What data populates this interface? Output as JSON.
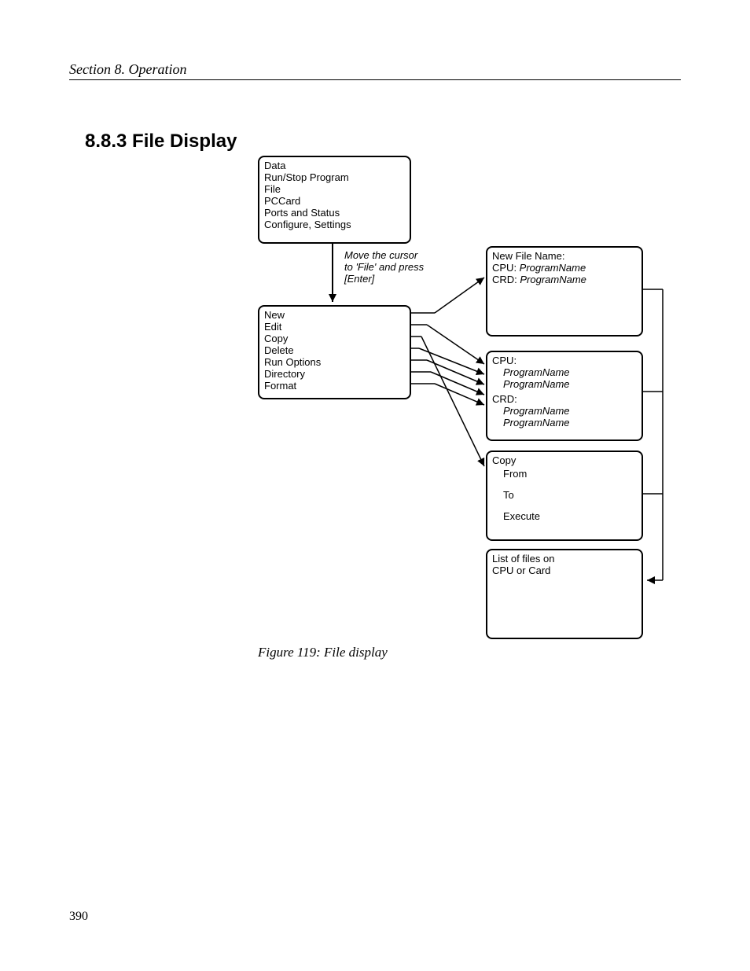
{
  "header": "Section 8.  Operation",
  "section_title": "8.8.3 File Display",
  "caption": "Figure 119: File display",
  "page_number": "390",
  "box_main": {
    "l1": "Data",
    "l2": "Run/Stop Program",
    "l3": "File",
    "l4": "PCCard",
    "l5": "Ports and Status",
    "l6": "Configure, Settings"
  },
  "instr": {
    "l1": "Move the cursor",
    "l2": "to 'File' and press",
    "l3": "[Enter]"
  },
  "box_file": {
    "l1": "New",
    "l2": "Edit",
    "l3": "Copy",
    "l4": "Delete",
    "l5": "Run Options",
    "l6": "Directory",
    "l7": "Format"
  },
  "box_newfile": {
    "title": "New File Name:",
    "l1a": "CPU:  ",
    "l1b": "ProgramName",
    "l2a": "CRD:  ",
    "l2b": "ProgramName"
  },
  "box_cpu": {
    "h1": "CPU:",
    "h2": "CRD:",
    "v": "ProgramName"
  },
  "box_copy": {
    "l1": "Copy",
    "l2": "From",
    "l3": "To",
    "l4": "Execute"
  },
  "box_list": {
    "l1": "List of files on",
    "l2": "CPU or Card"
  }
}
